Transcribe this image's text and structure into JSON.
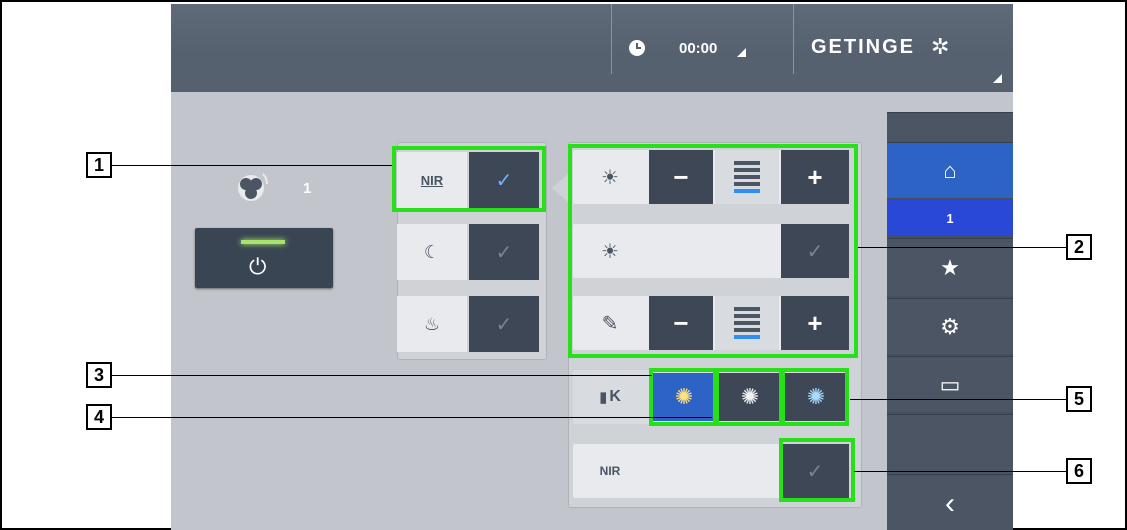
{
  "header": {
    "clock_time": "00:00",
    "brand_name": "GETINGE",
    "brand_logo": "✲"
  },
  "lamp": {
    "label": "1",
    "icon": "surgical-lamp-icon"
  },
  "power": {
    "icon": "power-icon",
    "led_color": "#a8e36e",
    "glyph": "⏻"
  },
  "modes": [
    {
      "name": "nir-mode",
      "icon_text": "NIR",
      "checked": true
    },
    {
      "name": "night-mode",
      "icon_text": "☾",
      "checked": false
    },
    {
      "name": "ambient-mode",
      "icon_text": "♨",
      "checked": false
    }
  ],
  "settings": {
    "illumination": {
      "icon": "sun-icon",
      "glyph": "☀",
      "minus": "−",
      "plus": "+",
      "level_bars": 5,
      "active_bar": 5
    },
    "auto_illumination": {
      "icon": "sun-level-icon",
      "glyph": "☀",
      "check": "✓"
    },
    "focus": {
      "icon": "focus-icon",
      "glyph": "✎",
      "minus": "−",
      "plus": "+",
      "level_bars": 5,
      "active_bar": 5
    },
    "color_temp": {
      "label": "K",
      "icon": "thermometer-icon",
      "options": [
        "warm",
        "neutral",
        "cool"
      ],
      "selected": 0
    },
    "nir_light": {
      "icon": "nir-light-icon",
      "text": "NIR",
      "check": "✓"
    }
  },
  "sidebar": {
    "items": [
      {
        "name": "home",
        "glyph": "⌂",
        "active": true
      },
      {
        "name": "lamp-1",
        "glyph": "1",
        "active": true
      },
      {
        "name": "favorites",
        "glyph": "★"
      },
      {
        "name": "settings",
        "glyph": "⚙"
      },
      {
        "name": "battery",
        "glyph": "▭"
      },
      {
        "name": "back",
        "glyph": "‹"
      }
    ]
  },
  "callouts": [
    "1",
    "2",
    "3",
    "4",
    "5",
    "6"
  ],
  "colors": {
    "highlight": "#28e01a",
    "selected_blue": "#2c63c4",
    "dark_button": "#3d4755"
  }
}
